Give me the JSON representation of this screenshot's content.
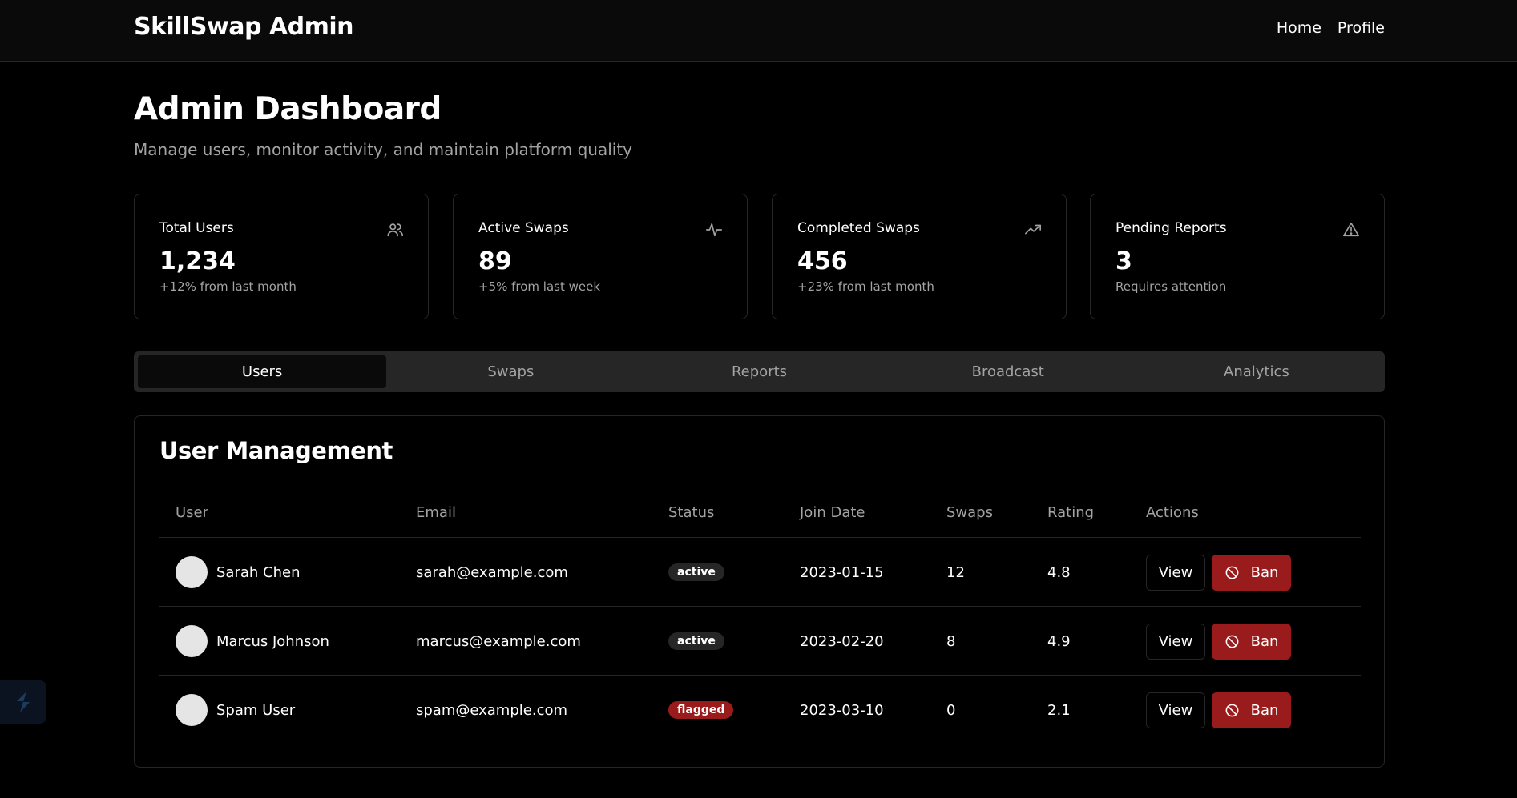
{
  "app": {
    "brand": "SkillSwap Admin",
    "nav": [
      "Home",
      "Profile"
    ]
  },
  "header": {
    "title": "Admin Dashboard",
    "subtitle": "Manage users, monitor activity, and maintain platform quality"
  },
  "stats": [
    {
      "label": "Total Users",
      "value": "1,234",
      "note": "+12% from last month",
      "icon": "users-icon"
    },
    {
      "label": "Active Swaps",
      "value": "89",
      "note": "+5% from last week",
      "icon": "activity-icon"
    },
    {
      "label": "Completed Swaps",
      "value": "456",
      "note": "+23% from last month",
      "icon": "trending-up-icon"
    },
    {
      "label": "Pending Reports",
      "value": "3",
      "note": "Requires attention",
      "icon": "alert-triangle-icon"
    }
  ],
  "tabs": [
    {
      "label": "Users",
      "active": true
    },
    {
      "label": "Swaps",
      "active": false
    },
    {
      "label": "Reports",
      "active": false
    },
    {
      "label": "Broadcast",
      "active": false
    },
    {
      "label": "Analytics",
      "active": false
    }
  ],
  "user_management": {
    "title": "User Management",
    "columns": [
      "User",
      "Email",
      "Status",
      "Join Date",
      "Swaps",
      "Rating",
      "Actions"
    ],
    "rows": [
      {
        "name": "Sarah Chen",
        "email": "sarah@example.com",
        "status": "active",
        "join_date": "2023-01-15",
        "swaps": "12",
        "rating": "4.8"
      },
      {
        "name": "Marcus Johnson",
        "email": "marcus@example.com",
        "status": "active",
        "join_date": "2023-02-20",
        "swaps": "8",
        "rating": "4.9"
      },
      {
        "name": "Spam User",
        "email": "spam@example.com",
        "status": "flagged",
        "join_date": "2023-03-10",
        "swaps": "0",
        "rating": "2.1"
      }
    ],
    "actions": {
      "view_label": "View",
      "ban_label": "Ban"
    }
  },
  "colors": {
    "background": "#000000",
    "border": "#262626",
    "danger": "#991b1b",
    "muted_text": "#a3a3a3"
  }
}
